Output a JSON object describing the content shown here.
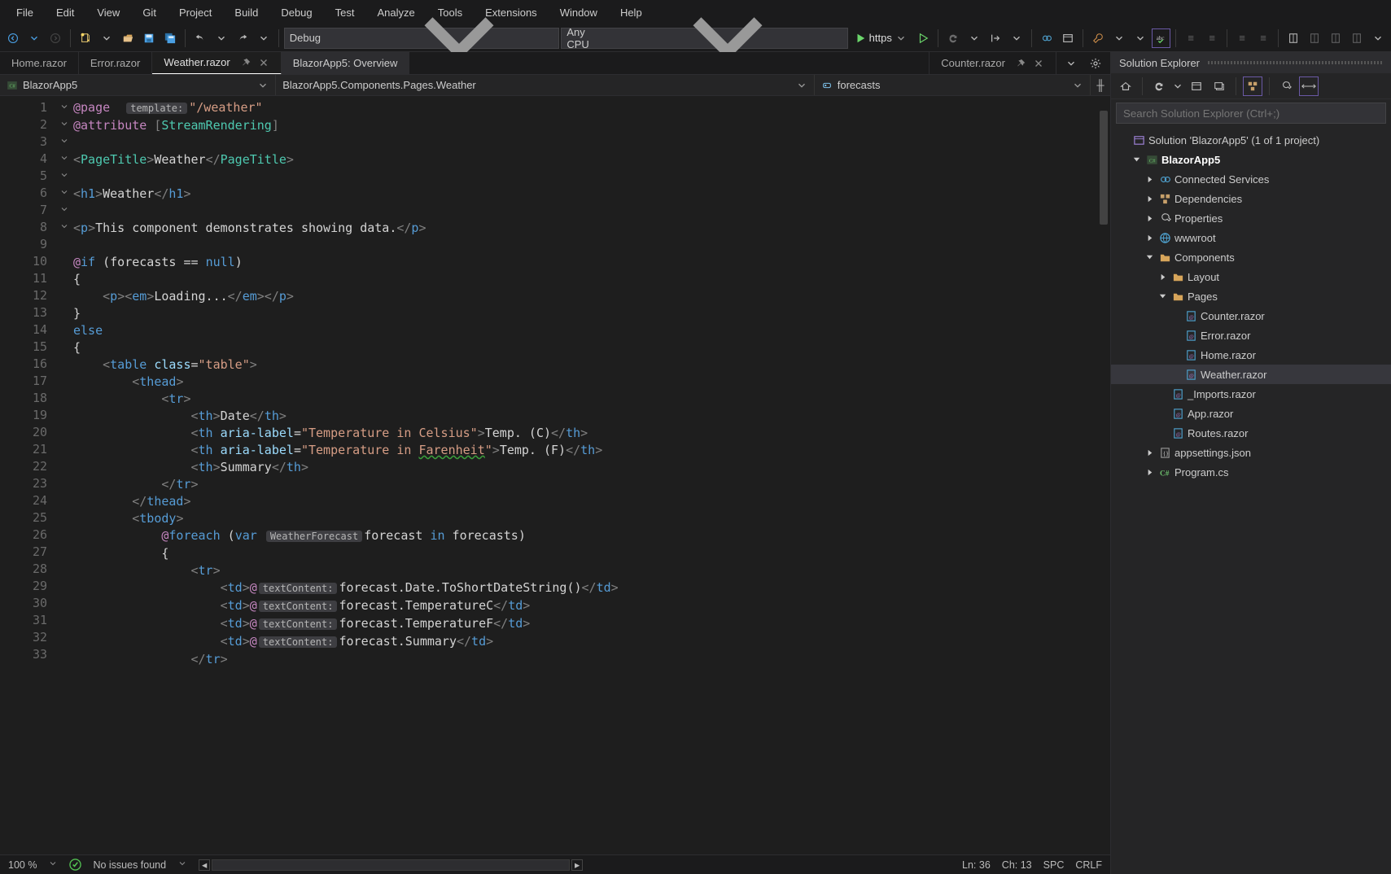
{
  "menu": {
    "items": [
      "File",
      "Edit",
      "View",
      "Git",
      "Project",
      "Build",
      "Debug",
      "Test",
      "Analyze",
      "Tools",
      "Extensions",
      "Window",
      "Help"
    ]
  },
  "toolbar": {
    "config": "Debug",
    "platform": "Any CPU",
    "launch": "https"
  },
  "tabs": [
    {
      "label": "Home.razor",
      "active": false
    },
    {
      "label": "Error.razor",
      "active": false
    },
    {
      "label": "Weather.razor",
      "active": true,
      "pinned": true,
      "close": true
    },
    {
      "label": "BlazorApp5: Overview",
      "active": false
    }
  ],
  "right_tab": {
    "label": "Counter.razor"
  },
  "navbar": {
    "project": "BlazorApp5",
    "class": "BlazorApp5.Components.Pages.Weather",
    "member": "forecasts"
  },
  "code_hints": {
    "template": "template:",
    "weather_forecast": "WeatherForecast",
    "text_content": "textContent:"
  },
  "code": {
    "page_route": "\"/weather\"",
    "attribute_name": "StreamRendering",
    "page_title": "Weather",
    "h1": "Weather",
    "paragraph": "This component demonstrates showing data.",
    "loading": "Loading...",
    "table_class": "\"table\"",
    "th_date": "Date",
    "th_c_aria": "\"Temperature in Celsius\"",
    "th_c": "Temp. (C)",
    "th_f_aria": "\"Temperature in Farenheit\"",
    "th_f": "Temp. (F)",
    "th_summary": "Summary",
    "td1": "forecast.Date.ToShortDateString()",
    "td2": "forecast.TemperatureC",
    "td3": "forecast.TemperatureF",
    "td4": "forecast.Summary"
  },
  "status": {
    "zoom": "100 %",
    "issues": "No issues found",
    "ln": "Ln: 36",
    "ch": "Ch: 13",
    "spaces": "SPC",
    "lineend": "CRLF"
  },
  "solution_explorer": {
    "title": "Solution Explorer",
    "search_placeholder": "Search Solution Explorer (Ctrl+;)",
    "tree": [
      {
        "depth": 0,
        "exp": "none",
        "icon": "sln",
        "label": "Solution 'BlazorApp5' (1 of 1 project)"
      },
      {
        "depth": 1,
        "exp": "open",
        "icon": "csproj",
        "label": "BlazorApp5",
        "bold": true
      },
      {
        "depth": 2,
        "exp": "closed",
        "icon": "connected",
        "label": "Connected Services"
      },
      {
        "depth": 2,
        "exp": "closed",
        "icon": "deps",
        "label": "Dependencies"
      },
      {
        "depth": 2,
        "exp": "closed",
        "icon": "props",
        "label": "Properties"
      },
      {
        "depth": 2,
        "exp": "closed",
        "icon": "globe",
        "label": "wwwroot"
      },
      {
        "depth": 2,
        "exp": "open",
        "icon": "folder",
        "label": "Components"
      },
      {
        "depth": 3,
        "exp": "closed",
        "icon": "folder",
        "label": "Layout"
      },
      {
        "depth": 3,
        "exp": "open",
        "icon": "folder",
        "label": "Pages"
      },
      {
        "depth": 4,
        "exp": "none",
        "icon": "razor",
        "label": "Counter.razor"
      },
      {
        "depth": 4,
        "exp": "none",
        "icon": "razor",
        "label": "Error.razor"
      },
      {
        "depth": 4,
        "exp": "none",
        "icon": "razor",
        "label": "Home.razor"
      },
      {
        "depth": 4,
        "exp": "none",
        "icon": "razor",
        "label": "Weather.razor",
        "selected": true
      },
      {
        "depth": 3,
        "exp": "none",
        "icon": "razor",
        "label": "_Imports.razor"
      },
      {
        "depth": 3,
        "exp": "none",
        "icon": "razor",
        "label": "App.razor"
      },
      {
        "depth": 3,
        "exp": "none",
        "icon": "razor",
        "label": "Routes.razor"
      },
      {
        "depth": 2,
        "exp": "closed",
        "icon": "json",
        "label": "appsettings.json"
      },
      {
        "depth": 2,
        "exp": "closed",
        "icon": "cs",
        "label": "Program.cs"
      }
    ]
  }
}
